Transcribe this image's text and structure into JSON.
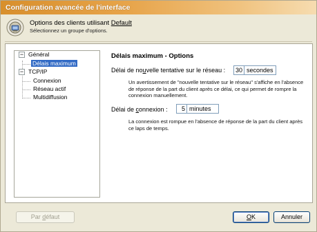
{
  "window": {
    "title": "Configuration avancée de l'interface"
  },
  "header": {
    "line1_prefix": "Options des clients utilisant ",
    "line1_link": "Default",
    "line2": "Sélectionnez un groupe d'options.",
    "icon": "settings-gear-icon"
  },
  "tree": {
    "items": [
      {
        "label": "Général",
        "expander": "−"
      },
      {
        "label": "Délais maximum",
        "selected": true
      },
      {
        "label": "TCP/IP",
        "expander": "−"
      },
      {
        "label": "Connexion"
      },
      {
        "label": "Réseau actif"
      },
      {
        "label": "Multidiffusion"
      }
    ]
  },
  "options": {
    "title": "Délais maximum - Options",
    "retry": {
      "label_a": "Délai de no",
      "label_u": "u",
      "label_b": "velle tentative sur le réseau :",
      "value": "30",
      "unit": "secondes",
      "note": "Un avertissement de \"nouvelle tentative sur le réseau\" s'affiche en l'absence de réponse de la part du client après ce délai, ce qui permet de rompre la connexion manuellement."
    },
    "connect": {
      "label_a": "Délai de ",
      "label_u": "c",
      "label_b": "onnexion :",
      "value": "5",
      "unit": "minutes",
      "note": "La connexion est rompue en l'absence de réponse de la part du client après ce laps de temps."
    }
  },
  "buttons": {
    "default_a": "Par ",
    "default_u": "d",
    "default_b": "éfaut",
    "ok_u": "O",
    "ok_b": "K",
    "cancel": "Annuler"
  }
}
